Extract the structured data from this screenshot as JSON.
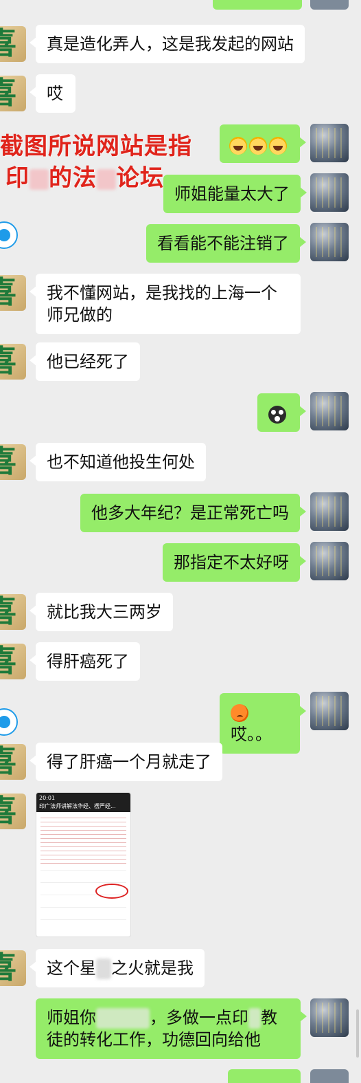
{
  "messages": [
    {
      "id": "m1",
      "side": "left",
      "text": "真是造化弄人，这是我发起的网站"
    },
    {
      "id": "m2",
      "side": "left",
      "text": "哎"
    },
    {
      "id": "m3",
      "side": "right",
      "emoji": [
        "laugh",
        "laugh",
        "laugh"
      ]
    },
    {
      "id": "m4",
      "side": "right",
      "text": "师姐能量太大了"
    },
    {
      "id": "m5",
      "side": "right",
      "text": "看看能不能注销了"
    },
    {
      "id": "m6",
      "side": "left",
      "text": "我不懂网站，是我找的上海一个师兄做的"
    },
    {
      "id": "m7",
      "side": "left",
      "text": "他已经死了"
    },
    {
      "id": "m8",
      "side": "right",
      "emoji": [
        "scared"
      ]
    },
    {
      "id": "m9",
      "side": "left",
      "text": "也不知道他投生何处"
    },
    {
      "id": "m10",
      "side": "right",
      "text": "他多大年纪？是正常死亡吗"
    },
    {
      "id": "m11",
      "side": "right",
      "text": "那指定不太好呀"
    },
    {
      "id": "m12",
      "side": "left",
      "text": "就比我大三两岁"
    },
    {
      "id": "m13",
      "side": "left",
      "text": "得肝癌死了"
    },
    {
      "id": "m14",
      "side": "right",
      "text": "哎。。",
      "emoji": [
        "sad"
      ]
    },
    {
      "id": "m15",
      "side": "left",
      "text": "得了肝癌一个月就走了"
    },
    {
      "id": "m16",
      "side": "left",
      "text_parts": [
        "这个星",
        "之火就是我"
      ]
    },
    {
      "id": "m17",
      "side": "right",
      "text_parts": [
        "师姐你",
        "，多做一点印",
        "教徒的转化工作，功德回向给他"
      ]
    }
  ],
  "annotation": {
    "line1": "截图所说网站是指",
    "line2_parts": [
      "印",
      "的法",
      "论坛"
    ]
  },
  "shared_screenshot": {
    "time": "20:01",
    "title": "印广法师讲解法华经、楞严经..."
  },
  "colors": {
    "background": "#ededed",
    "bubble_right": "#95ec69",
    "bubble_left": "#ffffff",
    "annotation": "#e0241b"
  }
}
